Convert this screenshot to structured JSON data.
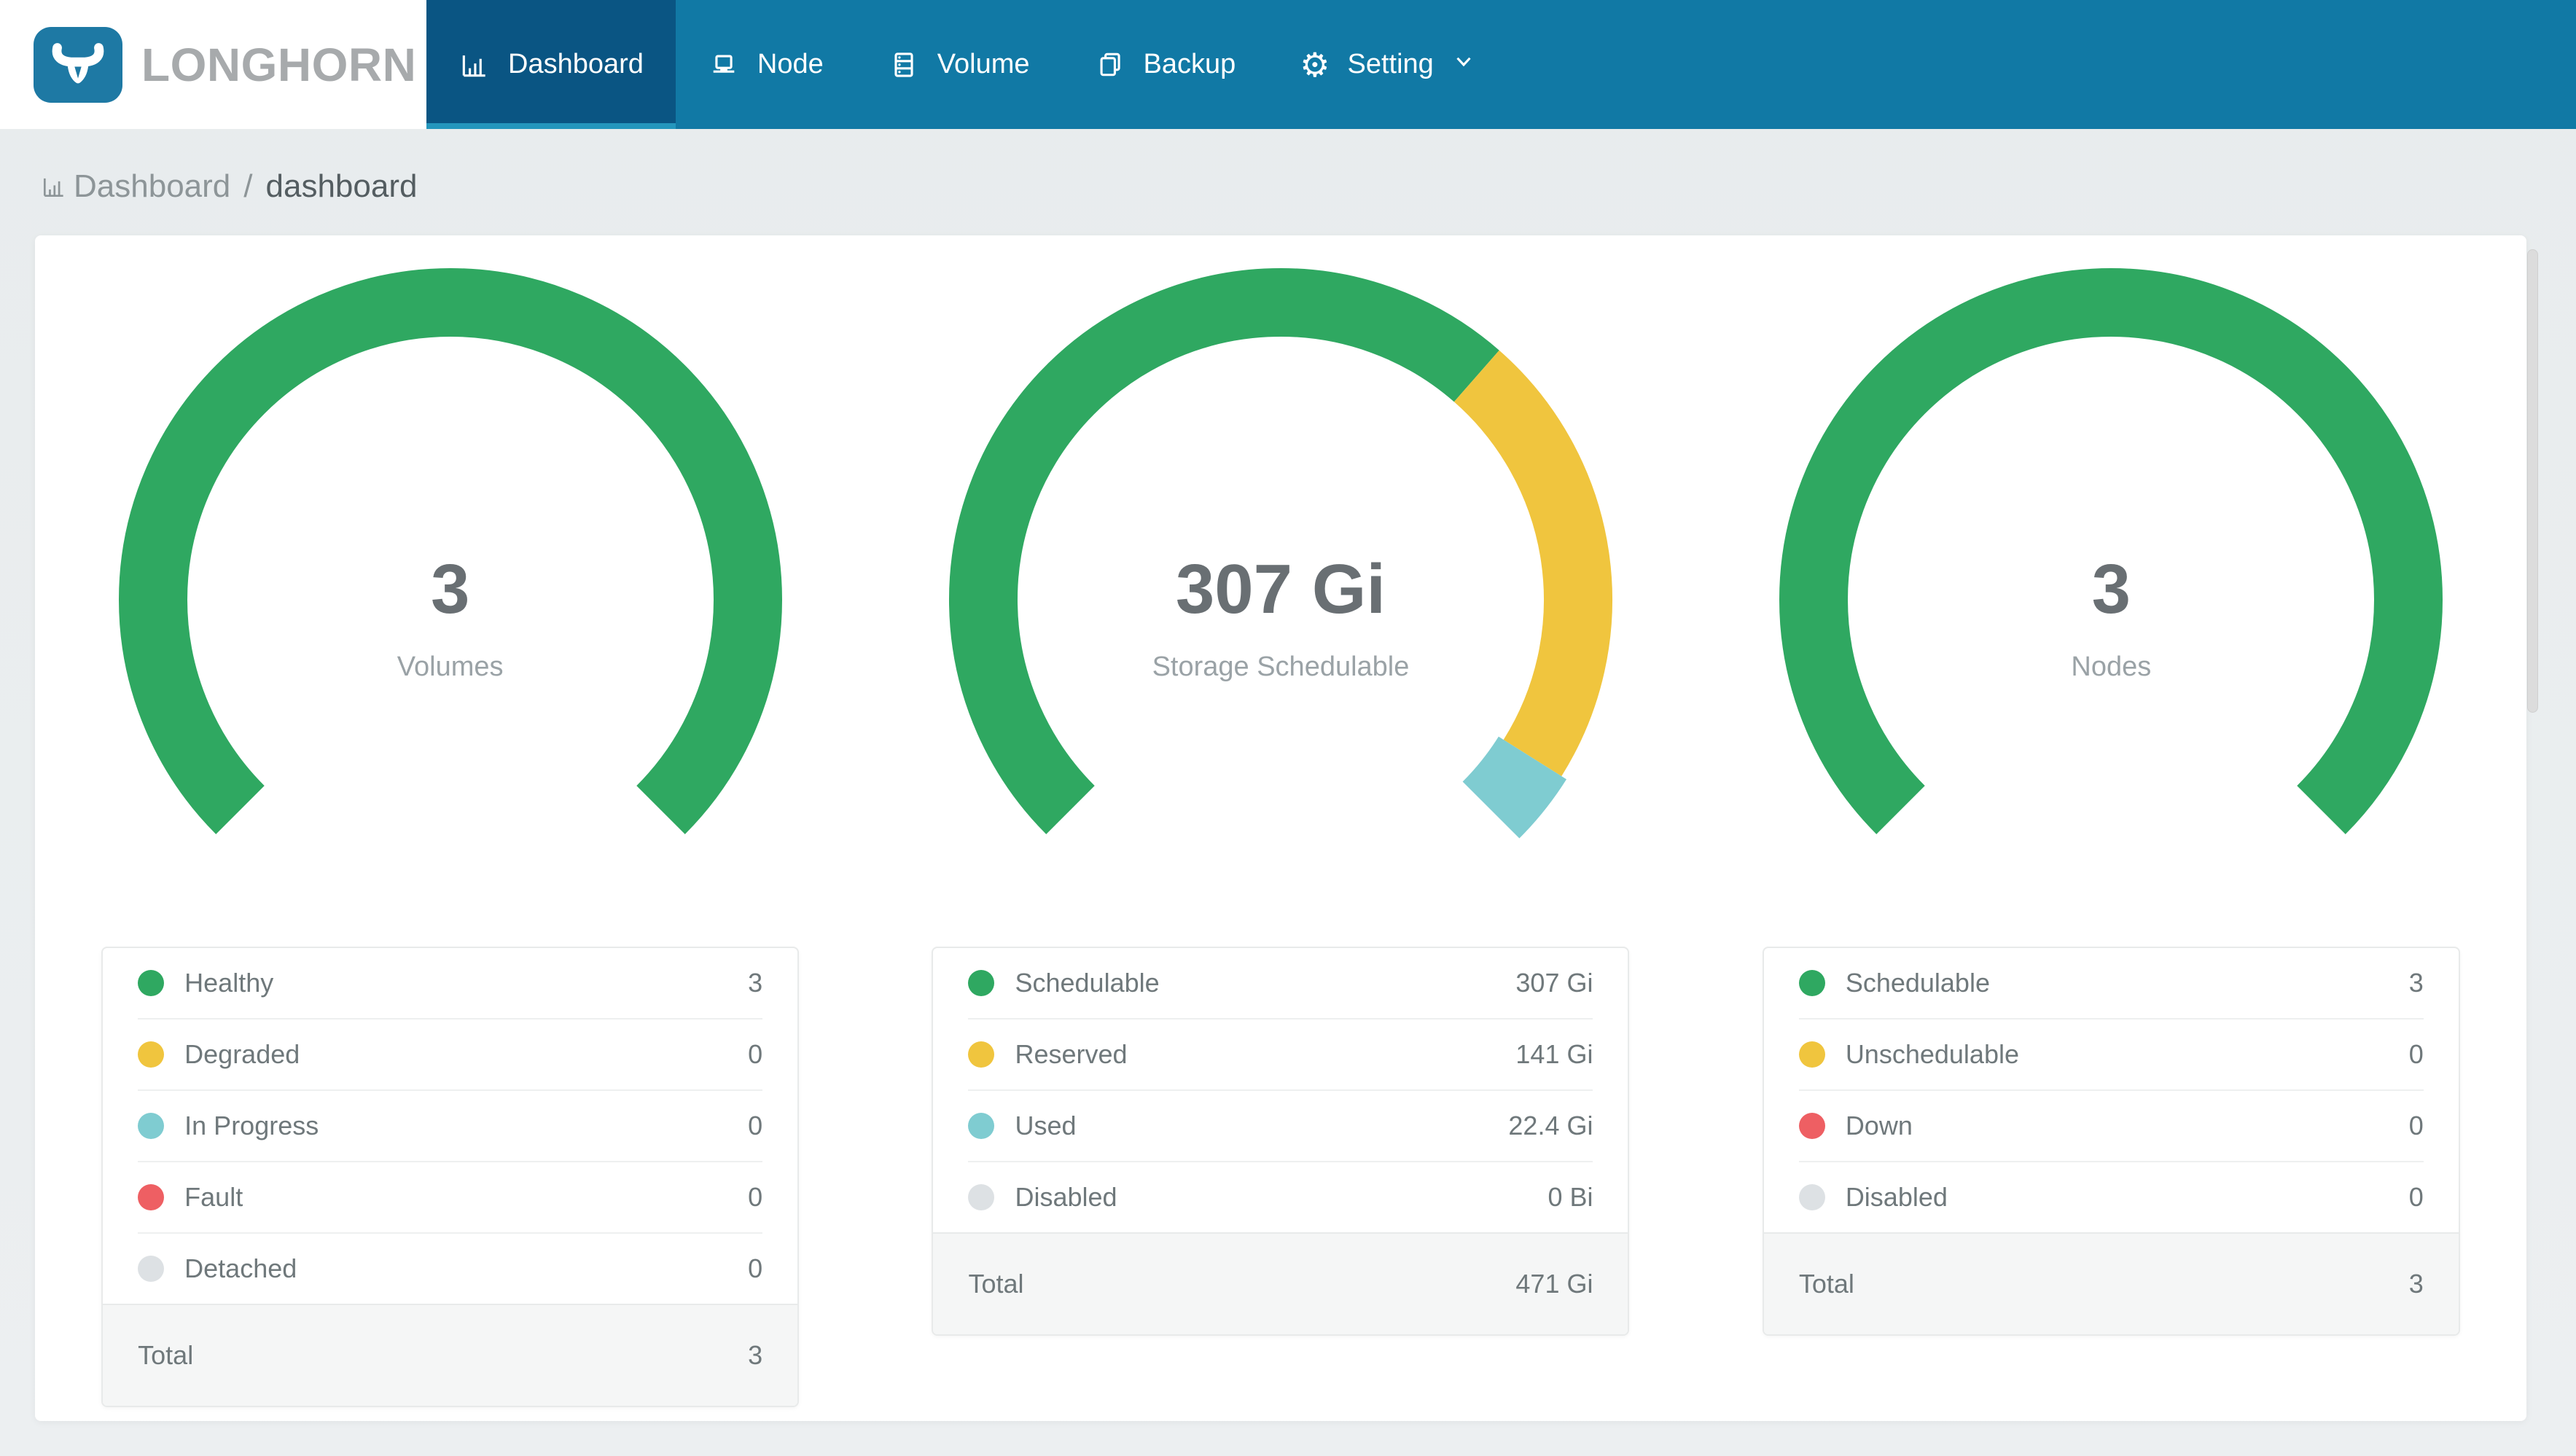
{
  "app": {
    "brand": "LONGHORN"
  },
  "nav": {
    "items": [
      {
        "label": "Dashboard",
        "icon": "bar-chart-icon",
        "active": true
      },
      {
        "label": "Node",
        "icon": "laptop-icon",
        "active": false
      },
      {
        "label": "Volume",
        "icon": "server-icon",
        "active": false
      },
      {
        "label": "Backup",
        "icon": "copy-icon",
        "active": false
      },
      {
        "label": "Setting",
        "icon": "gear-icon",
        "active": false,
        "has_chevron": true
      }
    ]
  },
  "breadcrumb": {
    "section": "Dashboard",
    "separator": "/",
    "page": "dashboard"
  },
  "colors": {
    "green": "#2fa861",
    "yellow": "#f0c53e",
    "teal": "#7fccd1",
    "red": "#ee5f63",
    "gray": "#dde1e4",
    "navbar": "#1179a5",
    "navbar_active": "#0a5583",
    "navbar_underline": "#2496bd",
    "logo_blue": "#1e79a4"
  },
  "chart_data": [
    {
      "type": "gauge",
      "title": "Volumes",
      "center_value": "3",
      "start_angle": 225,
      "span": 270,
      "segments": [
        {
          "label": "Healthy",
          "value": 3,
          "color": "green"
        },
        {
          "label": "Degraded",
          "value": 0,
          "color": "yellow"
        },
        {
          "label": "In Progress",
          "value": 0,
          "color": "teal"
        },
        {
          "label": "Fault",
          "value": 0,
          "color": "red"
        },
        {
          "label": "Detached",
          "value": 0,
          "color": "gray"
        }
      ]
    },
    {
      "type": "gauge",
      "title": "Storage Schedulable",
      "center_value": "307 Gi",
      "start_angle": 225,
      "span": 270,
      "segments": [
        {
          "label": "Schedulable",
          "value": 307,
          "color": "green"
        },
        {
          "label": "Reserved",
          "value": 141,
          "color": "yellow"
        },
        {
          "label": "Used",
          "value": 22.4,
          "color": "teal",
          "wide": true
        },
        {
          "label": "Disabled",
          "value": 0,
          "color": "gray"
        }
      ]
    },
    {
      "type": "gauge",
      "title": "Nodes",
      "center_value": "3",
      "start_angle": 225,
      "span": 270,
      "segments": [
        {
          "label": "Schedulable",
          "value": 3,
          "color": "green"
        },
        {
          "label": "Unschedulable",
          "value": 0,
          "color": "yellow"
        },
        {
          "label": "Down",
          "value": 0,
          "color": "red"
        },
        {
          "label": "Disabled",
          "value": 0,
          "color": "gray"
        }
      ]
    }
  ],
  "panels": [
    {
      "gauge_value": "3",
      "gauge_label": "Volumes",
      "legend": [
        {
          "label": "Healthy",
          "value": "3",
          "color": "green"
        },
        {
          "label": "Degraded",
          "value": "0",
          "color": "yellow"
        },
        {
          "label": "In Progress",
          "value": "0",
          "color": "teal"
        },
        {
          "label": "Fault",
          "value": "0",
          "color": "red"
        },
        {
          "label": "Detached",
          "value": "0",
          "color": "gray"
        }
      ],
      "total_label": "Total",
      "total_value": "3"
    },
    {
      "gauge_value": "307 Gi",
      "gauge_label": "Storage Schedulable",
      "legend": [
        {
          "label": "Schedulable",
          "value": "307 Gi",
          "color": "green"
        },
        {
          "label": "Reserved",
          "value": "141 Gi",
          "color": "yellow"
        },
        {
          "label": "Used",
          "value": "22.4 Gi",
          "color": "teal"
        },
        {
          "label": "Disabled",
          "value": "0 Bi",
          "color": "gray"
        }
      ],
      "total_label": "Total",
      "total_value": "471 Gi"
    },
    {
      "gauge_value": "3",
      "gauge_label": "Nodes",
      "legend": [
        {
          "label": "Schedulable",
          "value": "3",
          "color": "green"
        },
        {
          "label": "Unschedulable",
          "value": "0",
          "color": "yellow"
        },
        {
          "label": "Down",
          "value": "0",
          "color": "red"
        },
        {
          "label": "Disabled",
          "value": "0",
          "color": "gray"
        }
      ],
      "total_label": "Total",
      "total_value": "3"
    }
  ]
}
